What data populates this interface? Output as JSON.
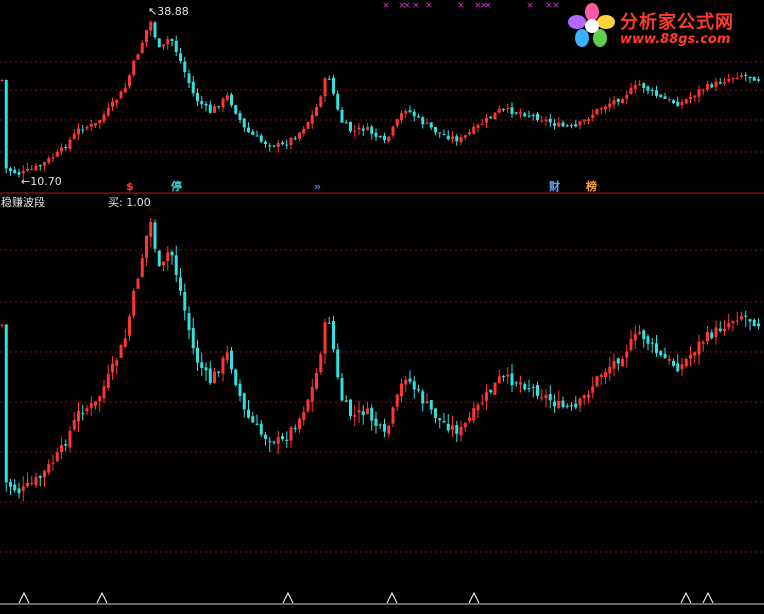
{
  "chart_data": [
    {
      "type": "candlestick",
      "title": "",
      "annotations": {
        "high_label": "38.88",
        "low_label": "10.70"
      },
      "markers": [
        {
          "label": "$",
          "color": "#ff3b3b"
        },
        {
          "label": "停",
          "color": "#33d6d6"
        },
        {
          "label": "»",
          "color": "#4d7dff"
        },
        {
          "label": "财",
          "color": "#66a8ff"
        },
        {
          "label": "榜",
          "color": "#ffa23a"
        }
      ],
      "top_signal_glyph": "×",
      "grid": true,
      "colors": {
        "up": "#ff3535",
        "down": "#33e0e0",
        "grid": "#8a1010",
        "separator": "#c01818"
      }
    },
    {
      "type": "candlestick",
      "title": "稳赚波段",
      "value_label": "买: 1.00",
      "bottom_signal": "△",
      "grid": true,
      "colors": {
        "up": "#ff3535",
        "down": "#33e0e0",
        "signal": "#ffffff"
      }
    }
  ],
  "logo": {
    "title": "分析家公式网",
    "url": "www.88gs.com"
  }
}
